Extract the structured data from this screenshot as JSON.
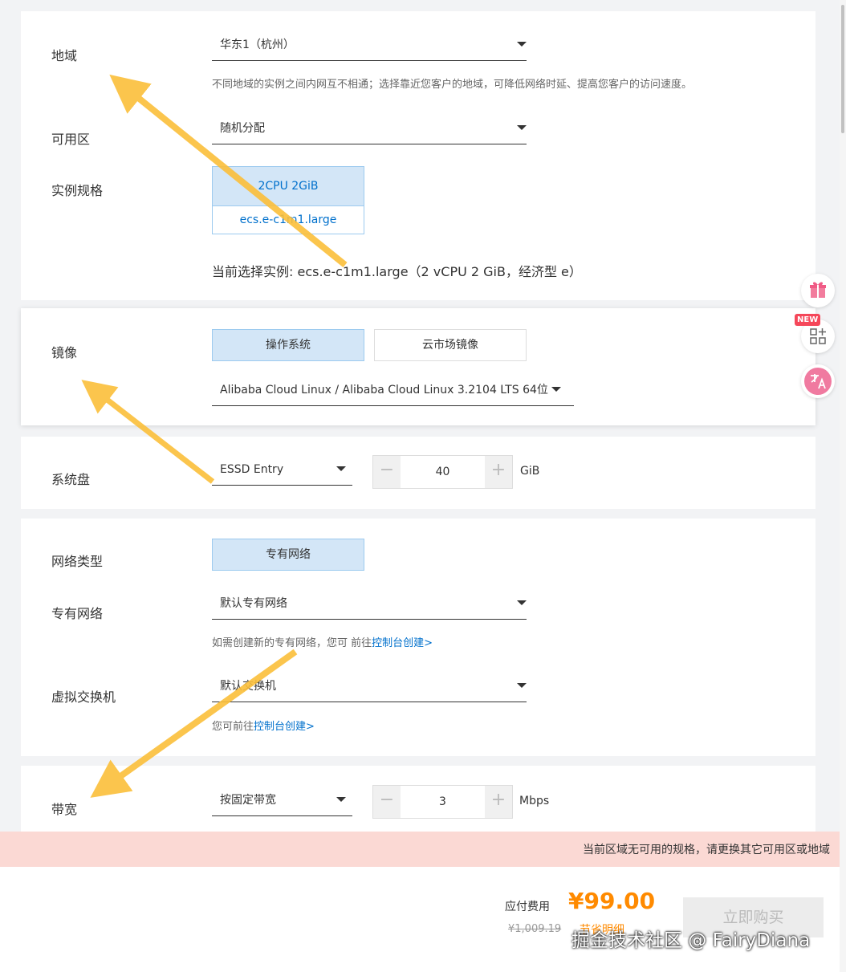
{
  "region": {
    "label": "地域",
    "value": "华东1（杭州）",
    "hint": "不同地域的实例之间内网互不相通；选择靠近您客户的地域，可降低网络时延、提高您客户的访问速度。"
  },
  "zone": {
    "label": "可用区",
    "value": "随机分配"
  },
  "instance": {
    "label": "实例规格",
    "spec": "2CPU 2GiB",
    "type": "ecs.e-c1m1.large",
    "current": "当前选择实例: ecs.e-c1m1.large（2 vCPU 2 GiB，经济型 e）"
  },
  "image": {
    "label": "镜像",
    "tabs": [
      "操作系统",
      "云市场镜像"
    ],
    "value": "Alibaba Cloud Linux / Alibaba Cloud Linux 3.2104 LTS 64位"
  },
  "disk": {
    "label": "系统盘",
    "type": "ESSD Entry",
    "size": "40",
    "unit": "GiB"
  },
  "network": {
    "type_label": "网络类型",
    "type_value": "专有网络",
    "vpc_label": "专有网络",
    "vpc_value": "默认专有网络",
    "vpc_hint": "如需创建新的专有网络，您可 前往",
    "vpc_link": "控制台创建>",
    "vswitch_label": "虚拟交换机",
    "vswitch_value": "默认交换机",
    "vswitch_hint": "您可前往",
    "vswitch_link": "控制台创建>"
  },
  "bandwidth": {
    "label": "带宽",
    "type": "按固定带宽",
    "value": "3",
    "unit": "Mbps"
  },
  "warning": "当前区域无可用的规格，请更换其它可用区或地域",
  "footer": {
    "fee_label": "应付费用",
    "price": "¥99.00",
    "original_price": "¥1,009.19",
    "detail_link": "节省明细",
    "buy_button": "立即购买",
    "watermark": "掘金技术社区 @ FairyDiana"
  },
  "side": {
    "new_badge": "NEW"
  },
  "colors": {
    "accent": "#ff8a00",
    "selected_bg": "#d3e6f7",
    "link": "#0070cc",
    "warning_bg": "#fbd9d4",
    "arrow": "#fbbf3a"
  }
}
